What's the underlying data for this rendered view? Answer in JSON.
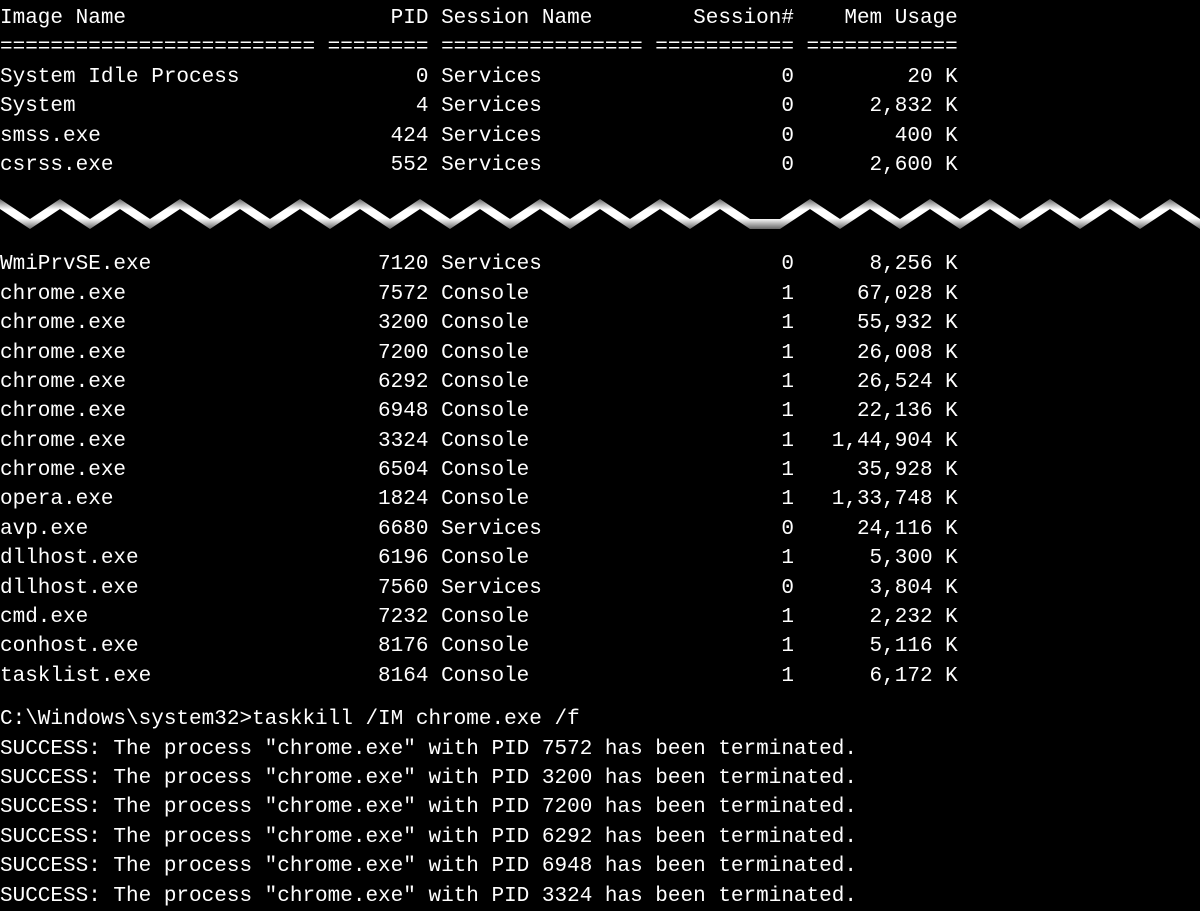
{
  "header": {
    "image_name": "Image Name",
    "pid": "PID",
    "session_name": "Session Name",
    "session_num": "Session#",
    "mem_usage": "Mem Usage"
  },
  "sep": "========================= ======== ================ =========== ============",
  "top_rows": [
    {
      "name": "System Idle Process",
      "pid": "0",
      "sess": "Services",
      "num": "0",
      "mem": "20 K"
    },
    {
      "name": "System",
      "pid": "4",
      "sess": "Services",
      "num": "0",
      "mem": "2,832 K"
    },
    {
      "name": "smss.exe",
      "pid": "424",
      "sess": "Services",
      "num": "0",
      "mem": "400 K"
    },
    {
      "name": "csrss.exe",
      "pid": "552",
      "sess": "Services",
      "num": "0",
      "mem": "2,600 K"
    }
  ],
  "cut_row": {
    "name": "WmiPrvSE.exe",
    "pid": "7120",
    "sess": "Services",
    "num": "0",
    "mem": "8,256 K"
  },
  "bottom_rows": [
    {
      "name": "chrome.exe",
      "pid": "7572",
      "sess": "Console",
      "num": "1",
      "mem": "67,028 K"
    },
    {
      "name": "chrome.exe",
      "pid": "3200",
      "sess": "Console",
      "num": "1",
      "mem": "55,932 K"
    },
    {
      "name": "chrome.exe",
      "pid": "7200",
      "sess": "Console",
      "num": "1",
      "mem": "26,008 K"
    },
    {
      "name": "chrome.exe",
      "pid": "6292",
      "sess": "Console",
      "num": "1",
      "mem": "26,524 K"
    },
    {
      "name": "chrome.exe",
      "pid": "6948",
      "sess": "Console",
      "num": "1",
      "mem": "22,136 K"
    },
    {
      "name": "chrome.exe",
      "pid": "3324",
      "sess": "Console",
      "num": "1",
      "mem": "1,44,904 K"
    },
    {
      "name": "chrome.exe",
      "pid": "6504",
      "sess": "Console",
      "num": "1",
      "mem": "35,928 K"
    },
    {
      "name": "opera.exe",
      "pid": "1824",
      "sess": "Console",
      "num": "1",
      "mem": "1,33,748 K"
    },
    {
      "name": "avp.exe",
      "pid": "6680",
      "sess": "Services",
      "num": "0",
      "mem": "24,116 K"
    },
    {
      "name": "dllhost.exe",
      "pid": "6196",
      "sess": "Console",
      "num": "1",
      "mem": "5,300 K"
    },
    {
      "name": "dllhost.exe",
      "pid": "7560",
      "sess": "Services",
      "num": "0",
      "mem": "3,804 K"
    },
    {
      "name": "cmd.exe",
      "pid": "7232",
      "sess": "Console",
      "num": "1",
      "mem": "2,232 K"
    },
    {
      "name": "conhost.exe",
      "pid": "8176",
      "sess": "Console",
      "num": "1",
      "mem": "5,116 K"
    },
    {
      "name": "tasklist.exe",
      "pid": "8164",
      "sess": "Console",
      "num": "1",
      "mem": "6,172 K"
    }
  ],
  "prompt": "C:\\Windows\\system32>taskkill /IM chrome.exe /f",
  "success_lines": [
    "SUCCESS: The process \"chrome.exe\" with PID 7572 has been terminated.",
    "SUCCESS: The process \"chrome.exe\" with PID 3200 has been terminated.",
    "SUCCESS: The process \"chrome.exe\" with PID 7200 has been terminated.",
    "SUCCESS: The process \"chrome.exe\" with PID 6292 has been terminated.",
    "SUCCESS: The process \"chrome.exe\" with PID 6948 has been terminated.",
    "SUCCESS: The process \"chrome.exe\" with PID 3324 has been terminated."
  ]
}
